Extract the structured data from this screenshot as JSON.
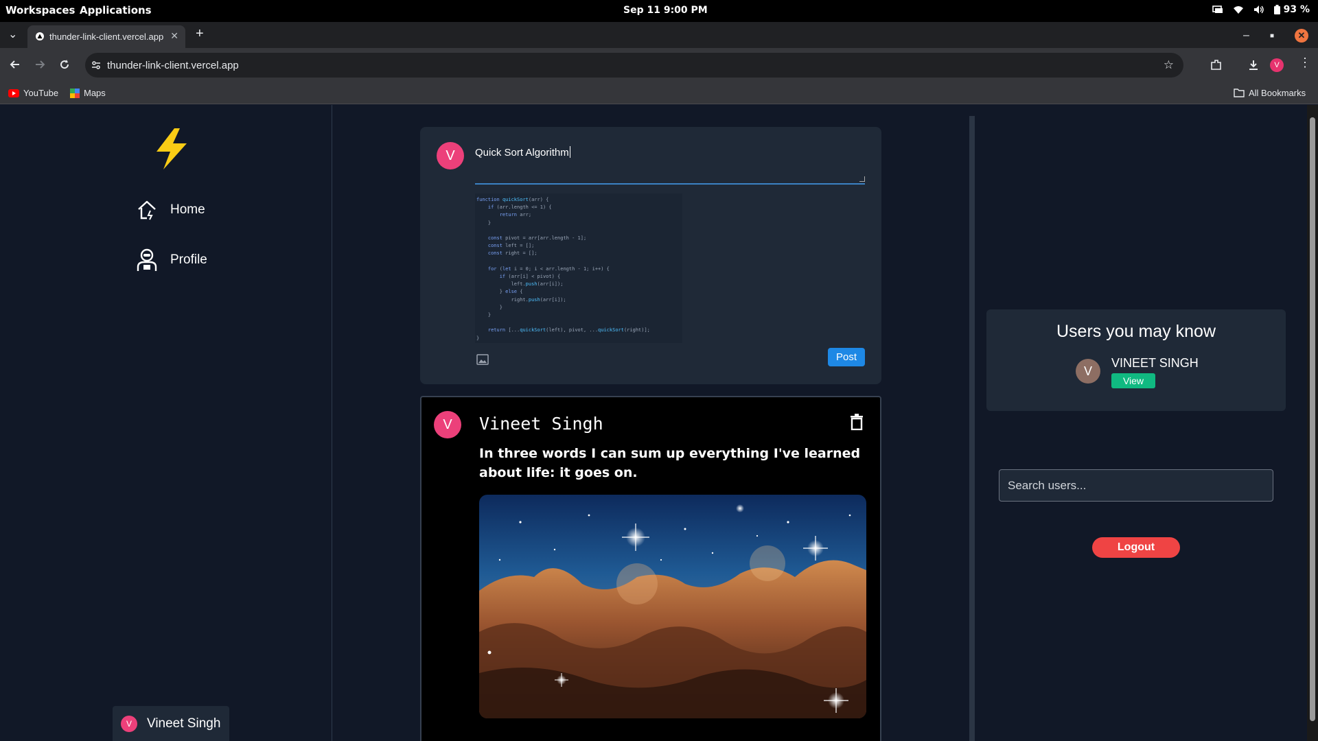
{
  "os": {
    "workspaces": "Workspaces",
    "applications": "Applications",
    "clock": "Sep 11  9:00 PM",
    "battery": "93 %"
  },
  "browser": {
    "tab_title": "thunder-link-client.vercel.app",
    "url": "thunder-link-client.vercel.app",
    "bookmarks": [
      {
        "label": "YouTube",
        "icon": "youtube-icon"
      },
      {
        "label": "Maps",
        "icon": "maps-icon"
      }
    ],
    "all_bookmarks": "All Bookmarks",
    "profile_initial": "V"
  },
  "sidebar": {
    "items": [
      {
        "label": "Home",
        "icon": "home-icon"
      },
      {
        "label": "Profile",
        "icon": "profile-icon"
      }
    ],
    "current_user": {
      "initial": "V",
      "name": "Vineet Singh"
    }
  },
  "composer": {
    "avatar_initial": "V",
    "text": "Quick Sort Algorithm",
    "code_lines": [
      "function quickSort(arr) {",
      "    if (arr.length <= 1) {",
      "        return arr;",
      "    }",
      "",
      "    const pivot = arr[arr.length - 1];",
      "    const left = [];",
      "    const right = [];",
      "",
      "    for (let i = 0; i < arr.length - 1; i++) {",
      "        if (arr[i] < pivot) {",
      "            left.push(arr[i]);",
      "        } else {",
      "            right.push(arr[i]);",
      "        }",
      "    }",
      "",
      "    return [...quickSort(left), pivot, ...quickSort(right)];",
      "}"
    ],
    "post_label": "Post"
  },
  "post": {
    "avatar_initial": "V",
    "author": "Vineet Singh",
    "body": "In three words I can sum up everything I've learned about life: it goes on."
  },
  "suggestions": {
    "title": "Users you may know",
    "users": [
      {
        "initial": "V",
        "name": "VINEET SINGH",
        "action": "View"
      }
    ]
  },
  "search": {
    "placeholder": "Search users..."
  },
  "logout_label": "Logout",
  "colors": {
    "accent": "#1e88e5",
    "avatar": "#ec407a",
    "view_button": "#10b981",
    "logout": "#ef4444",
    "logo": "#facc15",
    "page_bg": "#111827",
    "card_bg": "#1f2937"
  }
}
